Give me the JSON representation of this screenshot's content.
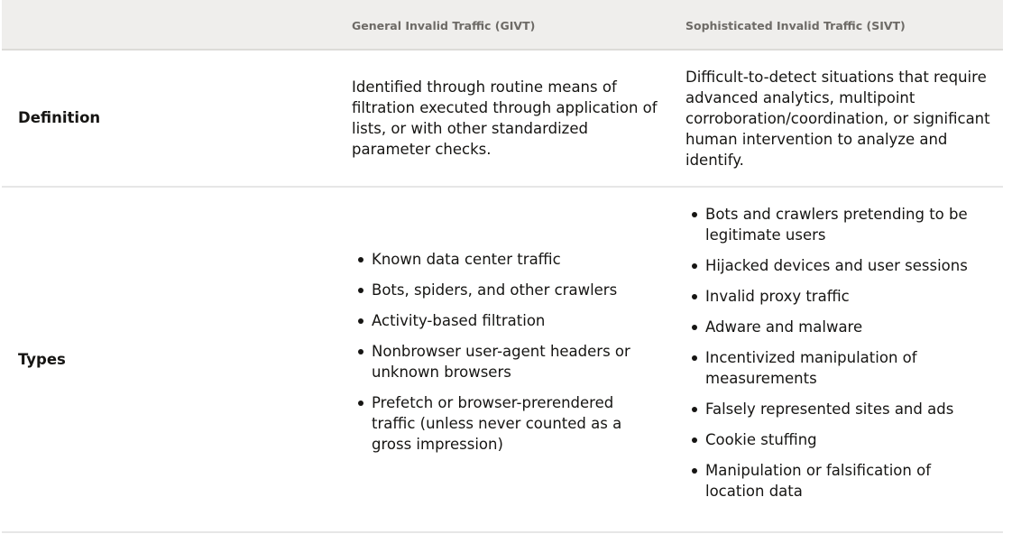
{
  "table": {
    "headers": [
      "",
      "General Invalid Traffic (GIVT)",
      "Sophisticated Invalid Traffic (SIVT)"
    ],
    "rows": [
      {
        "label": "Definition",
        "givt": "Identified through routine means of filtration executed through application of lists, or with other standardized parameter checks.",
        "sivt": "Difficult-to-detect situations that require advanced analytics, multipoint corroboration/coordination, or significant human intervention to analyze and identify."
      },
      {
        "label": "Types",
        "givt": [
          "Known data center traffic",
          "Bots, spiders, and other crawlers",
          "Activity-based filtration",
          "Nonbrowser user-agent headers or unknown browsers",
          "Prefetch or browser-prerendered traffic (unless never counted as a gross impression)"
        ],
        "sivt": [
          "Bots and crawlers pretending to be legitimate users",
          "Hijacked devices and user sessions",
          "Invalid proxy traffic",
          "Adware and malware",
          "Incentivized manipulation of measurements",
          "Falsely represented sites and ads",
          "Cookie stuffing",
          "Manipulation or falsification of location data"
        ]
      }
    ]
  }
}
